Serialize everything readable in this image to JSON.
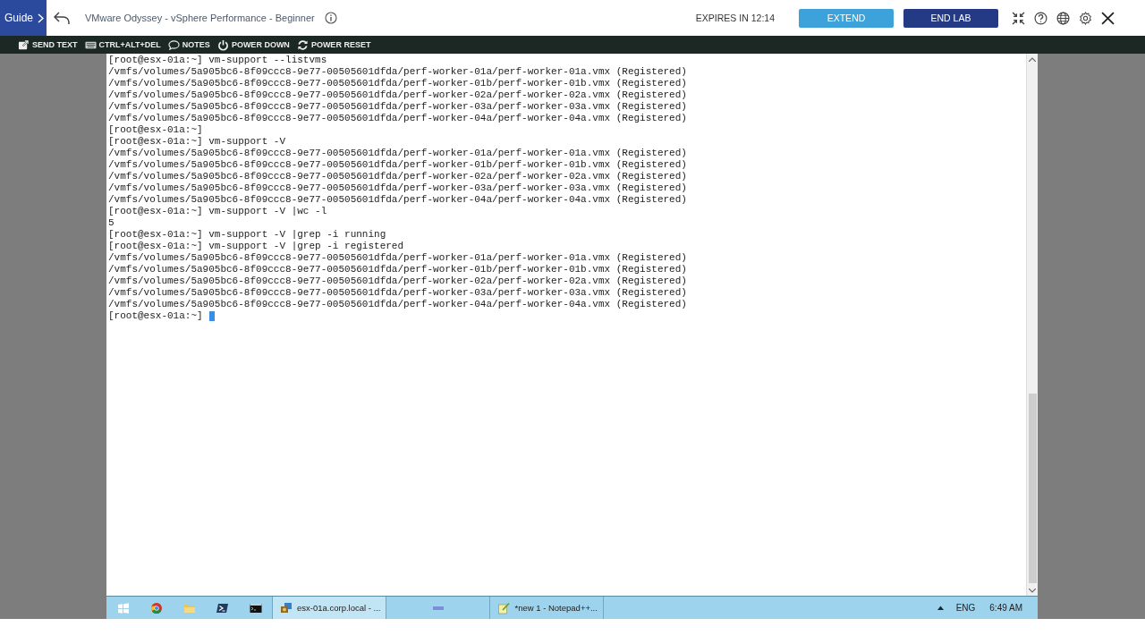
{
  "header": {
    "guide_button": "Guide",
    "title": "VMware Odyssey - vSphere Performance - Beginner",
    "expires": "EXPIRES IN 12:14",
    "extend_button": "EXTEND",
    "end_lab_button": "END LAB"
  },
  "toolbar": [
    "SEND TEXT",
    "CTRL+ALT+DEL",
    "NOTES",
    "POWER DOWN",
    "POWER RESET"
  ],
  "terminal": {
    "lines": [
      "[root@esx-01a:~] vm-support --listvms",
      "/vmfs/volumes/5a905bc6-8f09ccc8-9e77-00505601dfda/perf-worker-01a/perf-worker-01a.vmx (Registered)",
      "/vmfs/volumes/5a905bc6-8f09ccc8-9e77-00505601dfda/perf-worker-01b/perf-worker-01b.vmx (Registered)",
      "/vmfs/volumes/5a905bc6-8f09ccc8-9e77-00505601dfda/perf-worker-02a/perf-worker-02a.vmx (Registered)",
      "/vmfs/volumes/5a905bc6-8f09ccc8-9e77-00505601dfda/perf-worker-03a/perf-worker-03a.vmx (Registered)",
      "/vmfs/volumes/5a905bc6-8f09ccc8-9e77-00505601dfda/perf-worker-04a/perf-worker-04a.vmx (Registered)",
      "[root@esx-01a:~]",
      "[root@esx-01a:~] vm-support -V",
      "/vmfs/volumes/5a905bc6-8f09ccc8-9e77-00505601dfda/perf-worker-01a/perf-worker-01a.vmx (Registered)",
      "/vmfs/volumes/5a905bc6-8f09ccc8-9e77-00505601dfda/perf-worker-01b/perf-worker-01b.vmx (Registered)",
      "/vmfs/volumes/5a905bc6-8f09ccc8-9e77-00505601dfda/perf-worker-02a/perf-worker-02a.vmx (Registered)",
      "/vmfs/volumes/5a905bc6-8f09ccc8-9e77-00505601dfda/perf-worker-03a/perf-worker-03a.vmx (Registered)",
      "/vmfs/volumes/5a905bc6-8f09ccc8-9e77-00505601dfda/perf-worker-04a/perf-worker-04a.vmx (Registered)",
      "[root@esx-01a:~] vm-support -V |wc -l",
      "5",
      "[root@esx-01a:~] vm-support -V |grep -i running",
      "[root@esx-01a:~] vm-support -V |grep -i registered",
      "/vmfs/volumes/5a905bc6-8f09ccc8-9e77-00505601dfda/perf-worker-01a/perf-worker-01a.vmx (Registered)",
      "/vmfs/volumes/5a905bc6-8f09ccc8-9e77-00505601dfda/perf-worker-01b/perf-worker-01b.vmx (Registered)",
      "/vmfs/volumes/5a905bc6-8f09ccc8-9e77-00505601dfda/perf-worker-02a/perf-worker-02a.vmx (Registered)",
      "/vmfs/volumes/5a905bc6-8f09ccc8-9e77-00505601dfda/perf-worker-03a/perf-worker-03a.vmx (Registered)",
      "/vmfs/volumes/5a905bc6-8f09ccc8-9e77-00505601dfda/perf-worker-04a/perf-worker-04a.vmx (Registered)",
      "[root@esx-01a:~]"
    ],
    "cursor_visible": true
  },
  "taskbar": {
    "tasks": [
      {
        "label": "esx-01a.corp.local - ...",
        "selected": true
      },
      {
        "selected": false
      },
      {
        "label": "*new 1 - Notepad++...",
        "selected": false
      }
    ],
    "language": "ENG",
    "clock": "6:49 AM"
  }
}
